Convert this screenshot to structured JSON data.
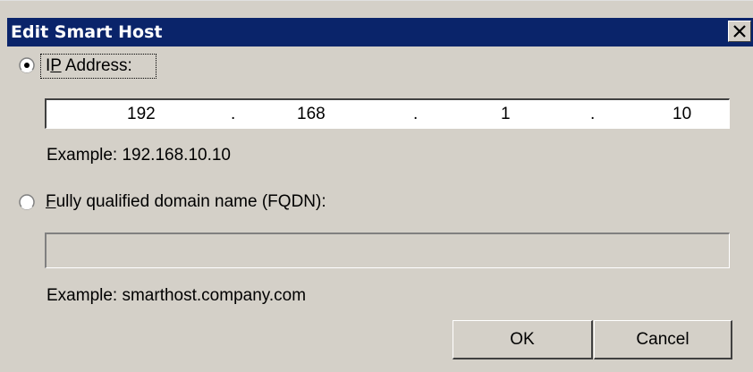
{
  "window": {
    "title": "Edit Smart Host",
    "titlebar_color": "#0a246a",
    "background_color": "#d4d0c8",
    "close_icon": "close-x-icon"
  },
  "ip_option": {
    "label_prefix": "I",
    "label_mnemonic": "P",
    "label_suffix": " Address:",
    "selected": true,
    "octets": [
      "192",
      "168",
      "1",
      "10"
    ],
    "separator": ".",
    "example": "Example: 192.168.10.10"
  },
  "fqdn_option": {
    "label_mnemonic": "F",
    "label_suffix": "ully qualified domain name (FQDN):",
    "selected": false,
    "value": "",
    "example": "Example: smarthost.company.com"
  },
  "buttons": {
    "ok": "OK",
    "cancel": "Cancel"
  }
}
